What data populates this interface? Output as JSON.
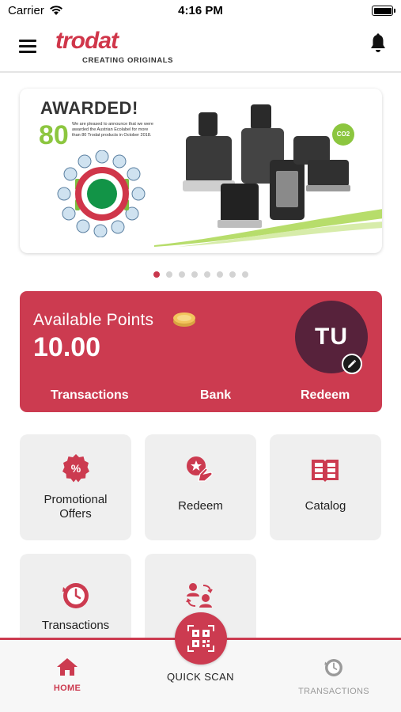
{
  "status_bar": {
    "carrier": "Carrier",
    "time": "4:16 PM"
  },
  "header": {
    "brand": "trodat",
    "tagline": "CREATING ORIGINALS"
  },
  "banner": {
    "headline": "AWARDED!",
    "number": "80",
    "blurb": "We are pleased to announce that we were awarded the Austrian Ecolabel for more than 80 Trodat products in October 2018.",
    "badge": "CO2",
    "slide_count": 8,
    "active_slide": 0
  },
  "points": {
    "label": "Available Points",
    "value": "10.00",
    "avatar_initials": "TU",
    "actions": [
      "Transactions",
      "Bank",
      "Redeem"
    ]
  },
  "tiles": [
    {
      "label": "Promotional Offers",
      "icon": "percent-badge-icon"
    },
    {
      "label": "Redeem",
      "icon": "redeem-hand-icon"
    },
    {
      "label": "Catalog",
      "icon": "catalog-book-icon"
    },
    {
      "label": "Transactions",
      "icon": "clock-history-icon"
    },
    {
      "label": "",
      "icon": "users-exchange-icon"
    }
  ],
  "bottom_nav": {
    "home": "HOME",
    "scan": "QUICK SCAN",
    "transactions": "TRANSACTIONS"
  },
  "colors": {
    "brand_red": "#cc3b50",
    "avatar_bg": "#57223b",
    "tile_bg": "#efefef",
    "inactive_nav": "#9a9a9a"
  }
}
